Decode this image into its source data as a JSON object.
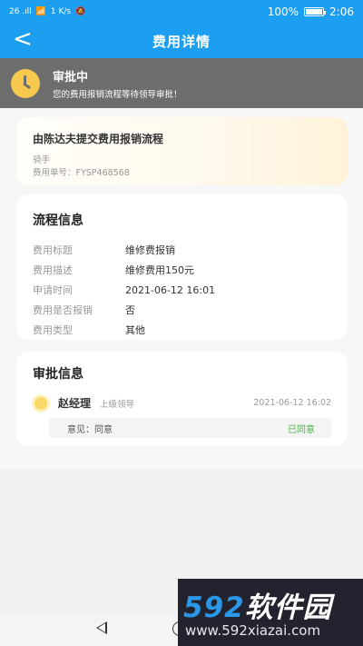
{
  "status_bar": {
    "signal": "26 .ıll",
    "speed": "1 K/s",
    "battery_text": "100%",
    "battery_level": 1.0,
    "time": "2:06"
  },
  "nav": {
    "title": "费用详情",
    "back_icon": "chevron-left-icon"
  },
  "banner": {
    "title": "审批中",
    "subtitle": "您的费用报销流程等待领导审批！",
    "icon": "clock-icon",
    "icon_color": "#f6c84d"
  },
  "process_card": {
    "title": "由陈达夫提交费用报销流程",
    "submitter_role": "骑手",
    "order_no": "费用单号：FYSP468568"
  },
  "flow_info": {
    "title": "流程信息",
    "rows": [
      {
        "k": "费用标题",
        "v": "维修费报销"
      },
      {
        "k": "费用描述",
        "v": "维修费用150元"
      },
      {
        "k": "申请时间",
        "v": "2021-06-12 16:01"
      },
      {
        "k": "费用是否报销",
        "v": "否"
      },
      {
        "k": "费用类型",
        "v": "其他"
      }
    ]
  },
  "approval_info": {
    "title": "审批信息",
    "approver": "赵经理",
    "role": "上级领导",
    "time": "2021-06-12 16:02",
    "opinion": "意见：同意",
    "status": "已同意",
    "status_color": "#4caf50"
  },
  "watermark": {
    "brand_num": "592",
    "brand_text": "软件园",
    "url": "www.592xiazai.com"
  },
  "colors": {
    "primary": "#1c9ef1",
    "banner_bg": "#6d6d6d"
  }
}
